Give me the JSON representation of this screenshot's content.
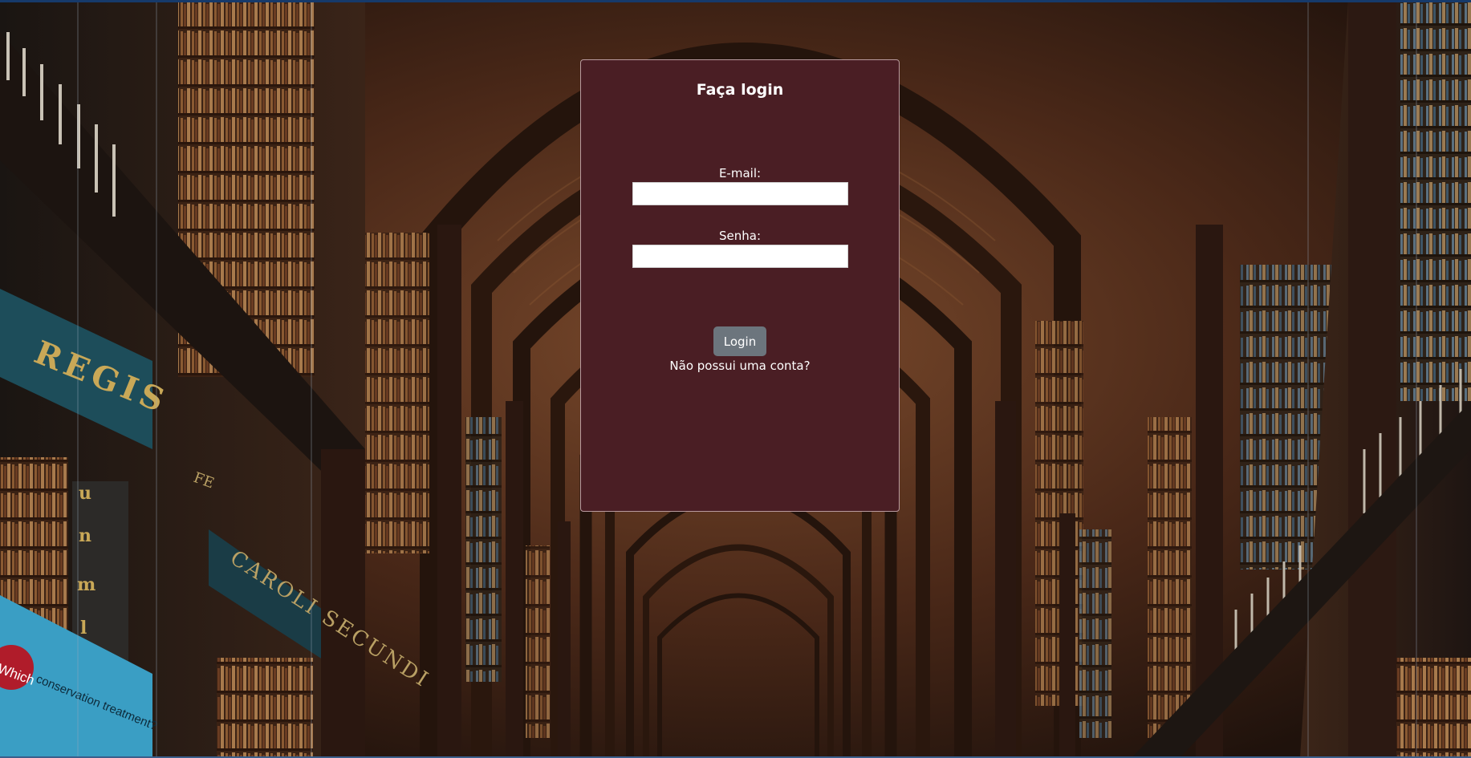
{
  "login": {
    "title": "Faça login",
    "email_label": "E-mail:",
    "email_value": "",
    "password_label": "Senha:",
    "password_value": "",
    "submit_label": "Login",
    "signup_link": "Não possui uma conta?"
  },
  "background": {
    "banner_top": "REGIS",
    "banner_lower": "CAROLI SECUNDI",
    "panel_letters": [
      "u",
      "n",
      "m",
      "l"
    ],
    "ad_word": "Which",
    "ad_text": "conservation treatment?",
    "pillar_text": "FE"
  },
  "colors": {
    "card_background": "#4a1e24",
    "button": "#6c757d",
    "page_top_edge": "#163a6b"
  }
}
